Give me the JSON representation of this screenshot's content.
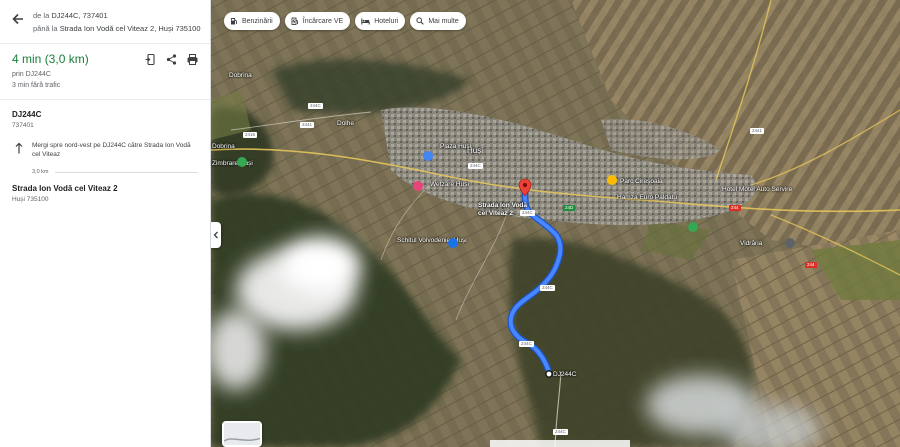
{
  "directions": {
    "from_prefix": "de la",
    "from_place": "DJ244C, 737401",
    "to_prefix": "până la",
    "to_place": "Strada Ion Vodă cel Viteaz 2, Huși 735100"
  },
  "summary": {
    "time": "4 min",
    "distance": "(3,0 km)",
    "via": "prin DJ244C",
    "traffic": "3 min fără trafic"
  },
  "start": {
    "name": "DJ244C",
    "sub": "737401"
  },
  "step": {
    "instruction": "Mergi spre nord-vest pe DJ244C către Strada Ion Vodă cel Viteaz",
    "distance": "3,0 km"
  },
  "destination": {
    "name": "Strada Ion Vodă cel Viteaz 2",
    "sub": "Huși 735100"
  },
  "chips": [
    {
      "label": "Benzinării",
      "icon": "gas-station-icon"
    },
    {
      "label": "Încărcare VE",
      "icon": "ev-charging-icon"
    },
    {
      "label": "Hoteluri",
      "icon": "hotel-icon"
    },
    {
      "label": "Mai multe",
      "icon": "search-icon"
    }
  ],
  "map": {
    "town": "Huși",
    "dest_marker_label": "Strada Ion Vodă cel Viteaz 2",
    "start_marker_label": "DJ244C",
    "places": [
      "Schitul Voivodenie, Huși",
      "Dobrina",
      "Dolhe",
      "Dobrina",
      "Zimbrare Huși",
      "Plaza Huși",
      "Wetzare Huși",
      "Hamza Euro Paldatu",
      "Hotel Motel Auto Servire",
      "Vidrăria",
      "Parc Cireșoaia"
    ],
    "road_shields": [
      "244C",
      "244C",
      "244C",
      "244C",
      "244C",
      "2415",
      "2441",
      "2441",
      "244",
      "244",
      "24D",
      "244C"
    ],
    "colors": {
      "route": "#4285f4",
      "dest_pin": "#ea4335"
    }
  }
}
